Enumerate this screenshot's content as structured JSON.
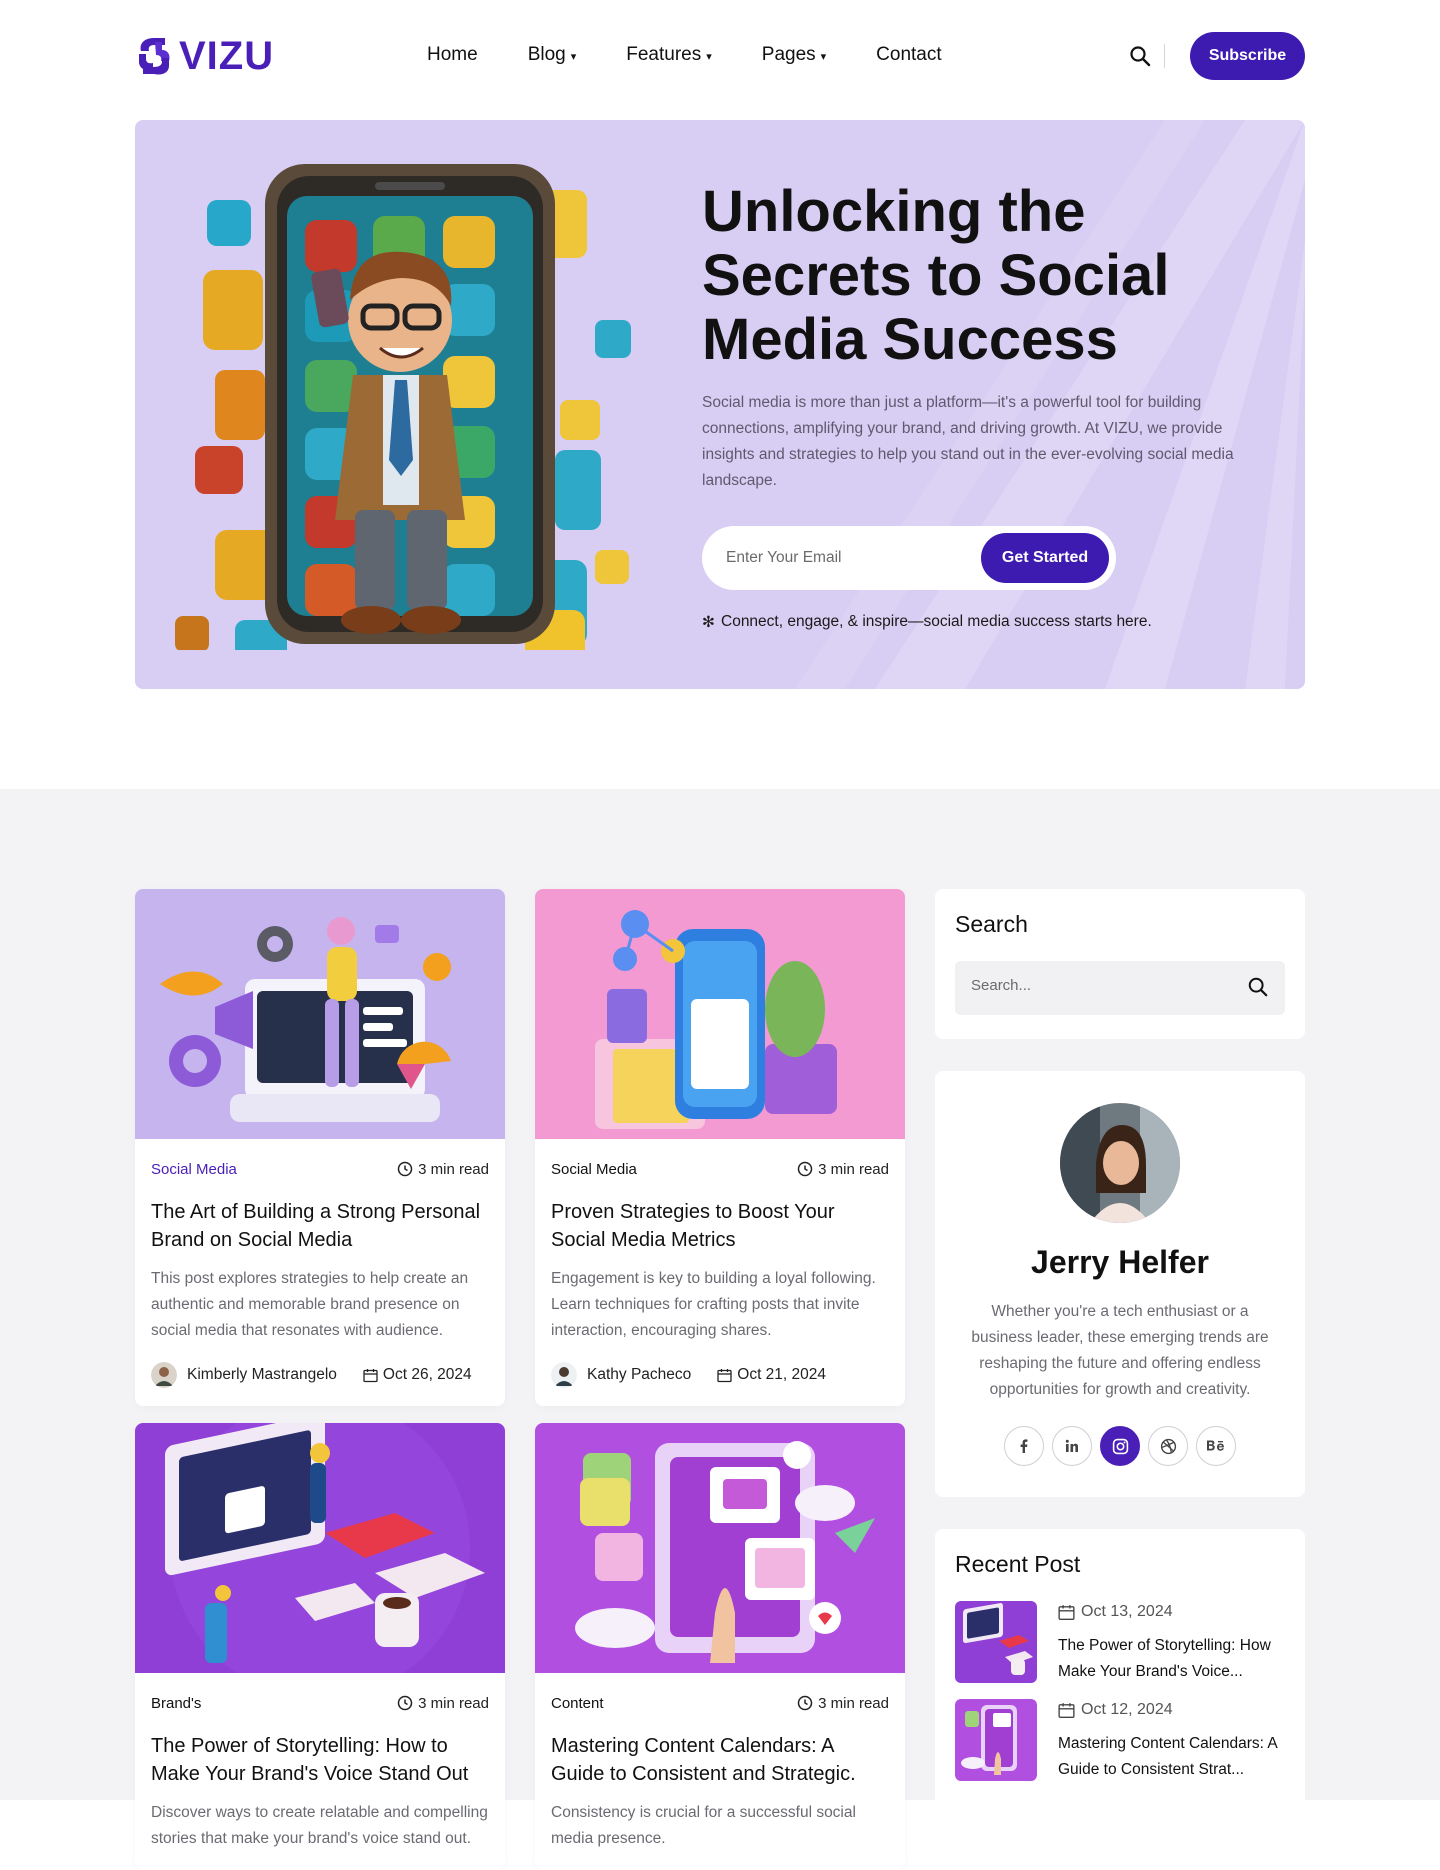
{
  "brand": {
    "name": "VIZU",
    "color": "#4a1fb8"
  },
  "nav": {
    "items": [
      {
        "label": "Home",
        "dropdown": false
      },
      {
        "label": "Blog",
        "dropdown": true
      },
      {
        "label": "Features",
        "dropdown": true
      },
      {
        "label": "Pages",
        "dropdown": true
      },
      {
        "label": "Contact",
        "dropdown": false
      }
    ],
    "subscribe_label": "Subscribe"
  },
  "hero": {
    "title": "Unlocking the Secrets to Social Media Success",
    "description": "Social media is more than just a platform—it's a powerful tool for building connections, amplifying your brand, and driving growth. At VIZU, we provide insights and strategies to help you stand out in the ever-evolving social media landscape.",
    "email_placeholder": "Enter Your Email",
    "cta_label": "Get Started",
    "note_icon": "✻",
    "note": "Connect, engage, & inspire—social media success starts here."
  },
  "posts": [
    {
      "category": "Social Media",
      "category_accent": true,
      "read_time": "3 min read",
      "title": "The Art of Building a Strong Personal Brand on Social Media",
      "excerpt": "This post explores strategies to help create an authentic and memorable brand presence on social media that resonates with audience.",
      "author": "Kimberly Mastrangelo",
      "date": "Oct 26, 2024"
    },
    {
      "category": "Social Media",
      "category_accent": false,
      "read_time": "3 min read",
      "title": "Proven Strategies to Boost Your Social Media Metrics",
      "excerpt": "Engagement is key to building a loyal following. Learn techniques for crafting posts that invite interaction, encouraging shares.",
      "author": "Kathy Pacheco",
      "date": "Oct 21, 2024"
    },
    {
      "category": "Brand's",
      "category_accent": false,
      "read_time": "3 min read",
      "title": "The Power of Storytelling: How to Make Your Brand's Voice Stand Out",
      "excerpt": "Discover ways to create relatable and compelling stories that make your brand's voice stand out.",
      "author": "",
      "date": ""
    },
    {
      "category": "Content",
      "category_accent": false,
      "read_time": "3 min read",
      "title": "Mastering Content Calendars: A Guide to Consistent and Strategic.",
      "excerpt": "Consistency is crucial for a successful social media presence.",
      "author": "",
      "date": ""
    }
  ],
  "sidebar": {
    "search": {
      "title": "Search",
      "placeholder": "Search..."
    },
    "profile": {
      "name": "Jerry Helfer",
      "bio": "Whether you're a tech enthusiast or a business leader, these emerging trends are reshaping the future and offering endless opportunities for growth and creativity.",
      "socials": [
        "facebook",
        "linkedin",
        "instagram",
        "dribbble",
        "behance"
      ],
      "active_social": "instagram"
    },
    "recent": {
      "title": "Recent Post",
      "items": [
        {
          "date": "Oct 13, 2024",
          "title": "The Power of Storytelling: How Make Your Brand's Voice..."
        },
        {
          "date": "Oct 12, 2024",
          "title": "Mastering Content Calendars: A Guide to Consistent Strat..."
        }
      ]
    }
  },
  "colors": {
    "accent": "#3d1bb0",
    "hero_bg": "#d8cdf2",
    "section_bg": "#f3f3f6"
  }
}
